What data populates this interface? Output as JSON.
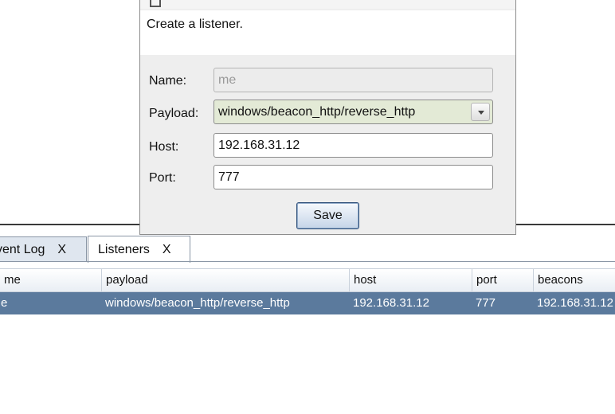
{
  "dialog": {
    "description": "Create a listener.",
    "fields": {
      "name_label": "Name:",
      "name_value": "me",
      "payload_label": "Payload:",
      "payload_value": "windows/beacon_http/reverse_http",
      "host_label": "Host:",
      "host_value": "192.168.31.12",
      "port_label": "Port:",
      "port_value": "777"
    },
    "save_label": "Save"
  },
  "tabs": [
    {
      "label": "vent Log",
      "close": "X"
    },
    {
      "label": "Listeners",
      "close": "X"
    }
  ],
  "table": {
    "columns": [
      "me",
      "payload",
      "host",
      "port",
      "beacons"
    ],
    "rows": [
      {
        "name": "e",
        "payload": "windows/beacon_http/reverse_http",
        "host": "192.168.31.12",
        "port": "777",
        "beacons": "192.168.31.12"
      }
    ]
  },
  "colors": {
    "selected_row": "#5b7a9d",
    "payload_select_bg": "#e3ead6",
    "button_border": "#2f4f79"
  }
}
